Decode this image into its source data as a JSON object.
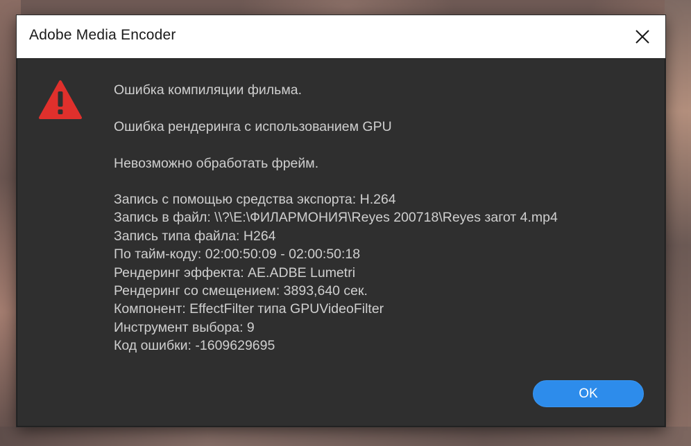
{
  "window": {
    "title": "Adobe Media Encoder",
    "close_icon": "close-icon"
  },
  "dialog": {
    "icon": "warning-triangle-icon",
    "icon_color": "#e0302c",
    "messages": [
      "Ошибка компиляции фильма.",
      "Ошибка рендеринга с использованием GPU",
      "Невозможно обработать фрейм."
    ],
    "details": [
      "Запись с помощью средства экспорта: H.264",
      "Запись в файл: \\\\?\\E:\\ФИЛАРМОНИЯ\\Reyes 200718\\Reyes загот 4.mp4",
      "Запись типа файла: H264",
      "По тайм-коду: 02:00:50:09 - 02:00:50:18",
      "Рендеринг эффекта: AE.ADBE Lumetri",
      "Рендеринг со смещением: 3893,640 сек.",
      "Компонент: EffectFilter типа GPUVideoFilter",
      "Инструмент выбора: 9",
      "Код ошибки: -1609629695"
    ],
    "ok_label": "OK",
    "ok_color": "#2d8ceb"
  }
}
